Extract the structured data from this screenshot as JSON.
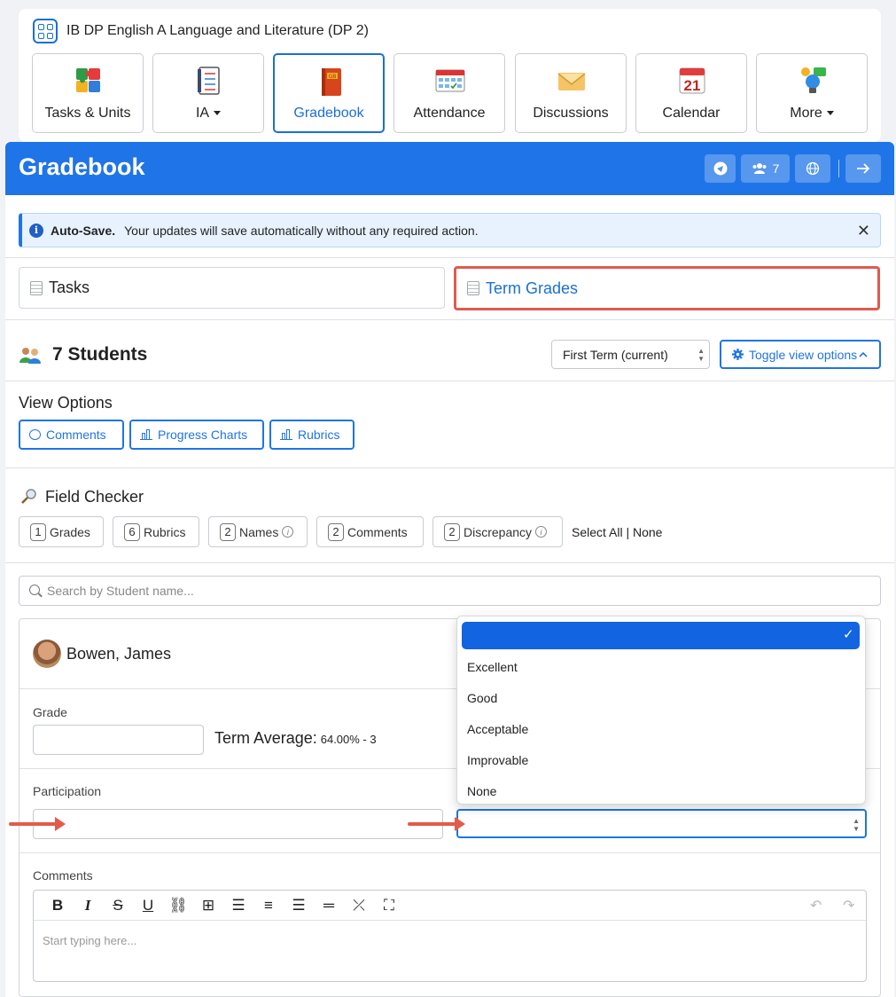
{
  "course": {
    "title": "IB DP English A Language and Literature (DP 2)"
  },
  "nav_tiles": [
    {
      "label": "Tasks & Units",
      "icon": "puzzle-icon"
    },
    {
      "label": "IA",
      "icon": "checklist-icon"
    },
    {
      "label": "Gradebook",
      "icon": "gradebook-icon"
    },
    {
      "label": "Attendance",
      "icon": "attendance-icon"
    },
    {
      "label": "Discussions",
      "icon": "envelope-icon"
    },
    {
      "label": "Calendar",
      "icon": "calendar-icon",
      "calendar_day": "21"
    },
    {
      "label": "More",
      "icon": "lightbulb-icon"
    }
  ],
  "header": {
    "title": "Gradebook",
    "people_count": "7"
  },
  "alert": {
    "title": "Auto-Save.",
    "message": "Your updates will save automatically without any required action."
  },
  "tabs": {
    "tasks": "Tasks",
    "term_grades": "Term Grades"
  },
  "students": {
    "title": "7 Students",
    "term_selected": "First Term (current)",
    "toggle_label": "Toggle view options"
  },
  "view_options": {
    "title": "View Options",
    "buttons": [
      "Comments",
      "Progress Charts",
      "Rubrics"
    ]
  },
  "field_checker": {
    "title": "Field Checker",
    "buttons": [
      {
        "count": "1",
        "label": "Grades"
      },
      {
        "count": "6",
        "label": "Rubrics"
      },
      {
        "count": "2",
        "label": "Names"
      },
      {
        "count": "2",
        "label": "Comments"
      },
      {
        "count": "2",
        "label": "Discrepancy"
      }
    ],
    "select_all": "Select All | None"
  },
  "search": {
    "placeholder": "Search by Student name..."
  },
  "student": {
    "name": "Bowen, James",
    "grade_label": "Grade",
    "term_average_label": "Term Average:",
    "term_average_value": "64.00% - 3",
    "participation_label": "Participation",
    "comments_label": "Comments",
    "editor_placeholder": "Start typing here..."
  },
  "dropdown_options": [
    "Excellent",
    "Good",
    "Acceptable",
    "Improvable",
    "None"
  ],
  "colors": {
    "primary": "#1f74e8",
    "highlight": "#e05a4f",
    "selected": "#1264e0"
  }
}
